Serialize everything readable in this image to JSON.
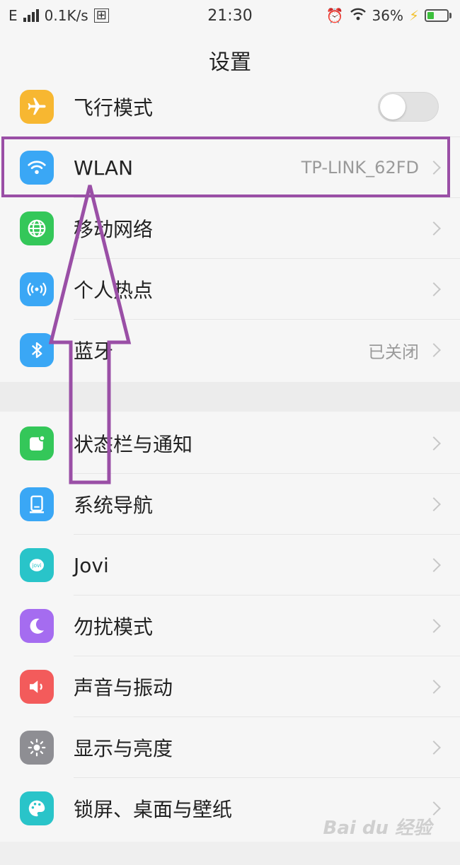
{
  "status_bar": {
    "network": "E",
    "speed": "0.1K/s",
    "time": "21:30",
    "battery": "36%",
    "battery_fraction": 0.36
  },
  "header": {
    "title": "设置"
  },
  "items": [
    {
      "label": "飞行模式",
      "icon": "airplane-icon",
      "color": "#f7b731",
      "toggle": false
    },
    {
      "label": "WLAN",
      "icon": "wifi-icon",
      "color": "#3aa7f5",
      "value": "TP-LINK_62FD"
    },
    {
      "label": "移动网络",
      "icon": "globe-icon",
      "color": "#34c759"
    },
    {
      "label": "个人热点",
      "icon": "hotspot-icon",
      "color": "#3aa7f5"
    },
    {
      "label": "蓝牙",
      "icon": "bluetooth-icon",
      "color": "#3aa7f5",
      "value": "已关闭"
    },
    {
      "label": "状态栏与通知",
      "icon": "notification-icon",
      "color": "#34c759"
    },
    {
      "label": "系统导航",
      "icon": "navigation-icon",
      "color": "#3aa7f5"
    },
    {
      "label": "Jovi",
      "icon": "jovi-icon",
      "color": "#29c4c9"
    },
    {
      "label": "勿扰模式",
      "icon": "moon-icon",
      "color": "#a56cf0"
    },
    {
      "label": "声音与振动",
      "icon": "speaker-icon",
      "color": "#f35b5b"
    },
    {
      "label": "显示与亮度",
      "icon": "sun-icon",
      "color": "#8e8e93"
    },
    {
      "label": "锁屏、桌面与壁纸",
      "icon": "palette-icon",
      "color": "#29c4c9"
    }
  ],
  "watermark": "Bai du 经验"
}
